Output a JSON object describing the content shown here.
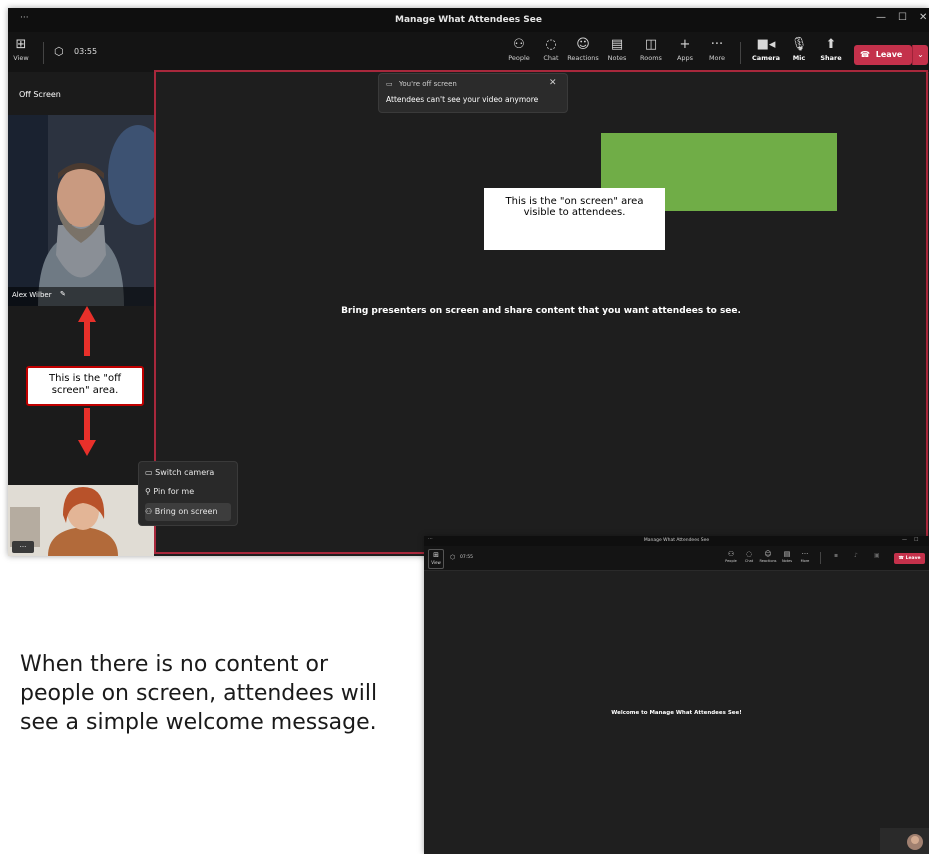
{
  "main": {
    "title": "Manage What Attendees See",
    "titlebar_dots": "···",
    "timer": "03:55",
    "view_label": "View",
    "toolbar": [
      "People",
      "Chat",
      "Reactions",
      "Notes",
      "Rooms",
      "Apps",
      "More"
    ],
    "toolbar_bold": [
      "Camera",
      "Mic",
      "Share"
    ],
    "leave_label": "Leave",
    "off_screen_title": "Off Screen",
    "presenter_name": "Alex Wilber",
    "toast_title": "You're off screen",
    "toast_body": "Attendees can't see your video anymore",
    "center_message": "Bring presenters on screen and share content that you want attendees to see.",
    "menu": [
      "Switch camera",
      "Pin for me",
      "Bring on screen"
    ]
  },
  "annotations": {
    "on_screen_note": "This is the \"on screen\" area visible to attendees.",
    "off_screen_note": "This is the \"off screen\" area."
  },
  "second": {
    "title": "Manage What Attendees See",
    "timer": "07:55",
    "view_label": "View",
    "toolbar": [
      "People",
      "Chat",
      "Reactions",
      "Notes",
      "More"
    ],
    "leave_label": "Leave",
    "welcome": "Welcome to Manage What Attendees See!"
  },
  "caption": "When there is no content or people on screen, attendees will see a simple welcome message.",
  "colors": {
    "accent_red": "#c4314b",
    "green_box": "#70ad47",
    "annotation_red": "#e8302a"
  }
}
